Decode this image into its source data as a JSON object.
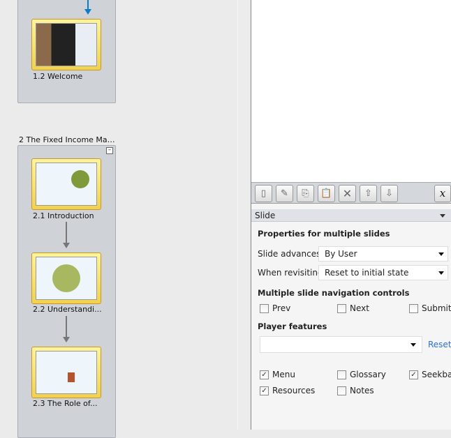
{
  "slides_panel": {
    "scene1": {
      "slides": [
        {
          "label": "1.2 Welcome"
        }
      ]
    },
    "scene2": {
      "title": "2 The Fixed Income Mar...",
      "slides": [
        {
          "label": "2.1 Introduction"
        },
        {
          "label": "2.2 Understandi..."
        },
        {
          "label": "2.3 The Role of..."
        }
      ]
    },
    "accent_arrow_color": "#0a7ccc"
  },
  "toolbar": {
    "buttons": [
      "new-slide-icon",
      "edit-icon",
      "copy-icon",
      "paste-icon",
      "delete-icon",
      "move-up-icon",
      "move-down-icon"
    ],
    "variables_label": "x"
  },
  "properties": {
    "header": "Slide",
    "section_title": "Properties for multiple slides",
    "slide_advances_label": "Slide advances:",
    "slide_advances_value": "By User",
    "revisiting_label": "When revisiting:",
    "revisiting_value": "Reset to initial state",
    "nav_title": "Multiple slide navigation controls",
    "nav_controls": [
      {
        "label": "Prev",
        "checked": false
      },
      {
        "label": "Next",
        "checked": false
      },
      {
        "label": "Submit",
        "checked": false
      }
    ],
    "player_title": "Player features",
    "player_select_value": "",
    "reset_label": "Reset",
    "features": [
      {
        "label": "Menu",
        "checked": true
      },
      {
        "label": "Glossary",
        "checked": false
      },
      {
        "label": "Seekbar",
        "checked": true
      },
      {
        "label": "Resources",
        "checked": true
      },
      {
        "label": "Notes",
        "checked": false
      }
    ]
  }
}
